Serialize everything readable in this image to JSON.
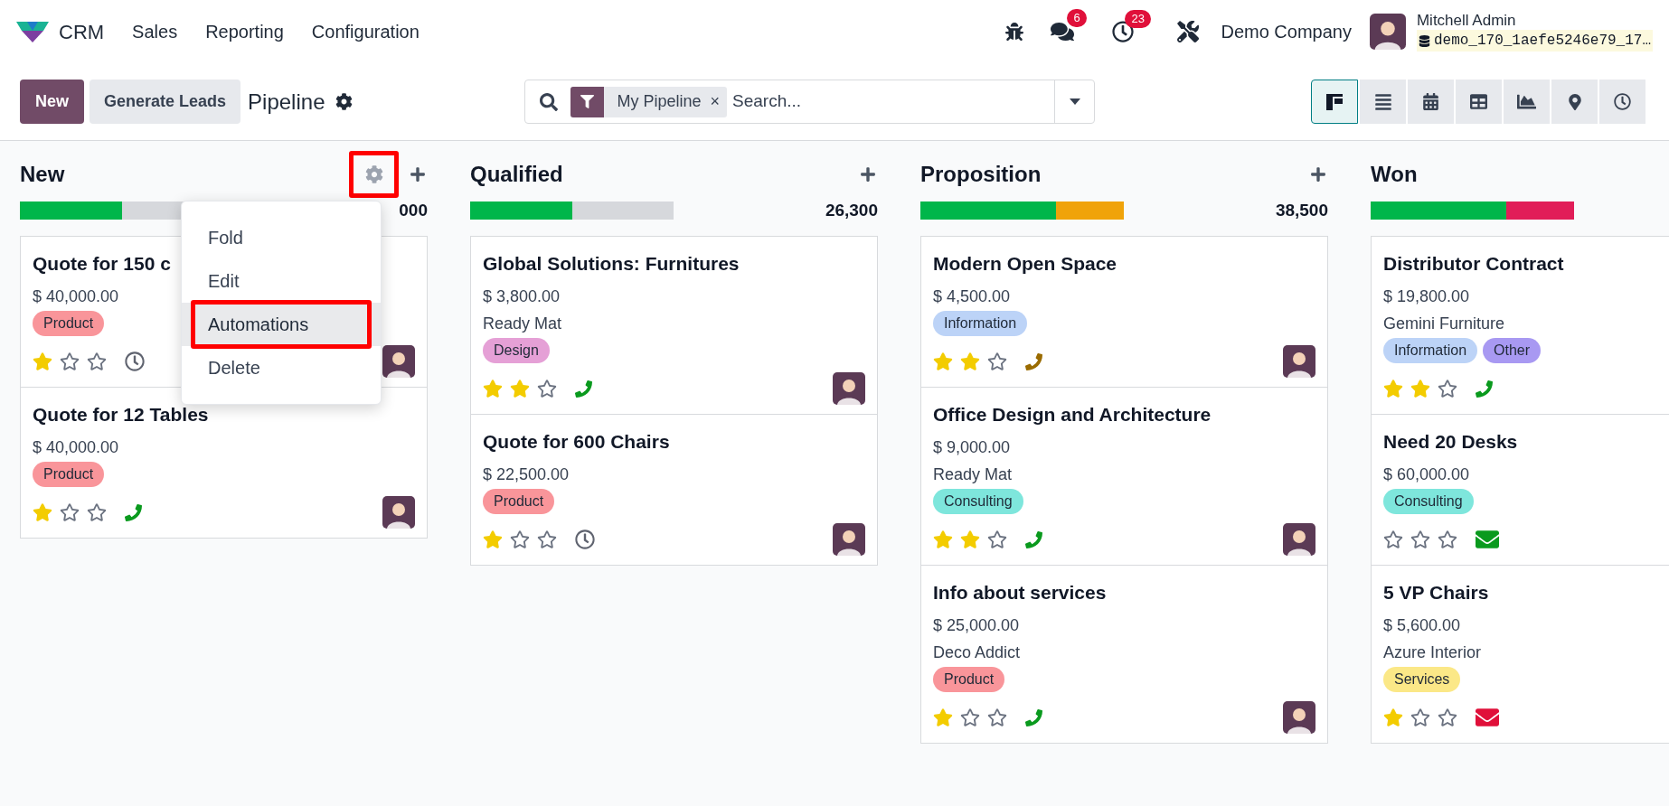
{
  "navbar": {
    "app_name": "CRM",
    "menu": [
      "Sales",
      "Reporting",
      "Configuration"
    ],
    "messages_badge": "6",
    "activities_badge": "23",
    "company": "Demo Company",
    "user": "Mitchell Admin",
    "database": "demo_170_1aefe5246e79_17…"
  },
  "control_panel": {
    "buttons": [
      {
        "label": "New",
        "kind": "primary"
      },
      {
        "label": "Generate Leads",
        "kind": "secondary"
      }
    ],
    "title": "Pipeline",
    "search": {
      "facet": "My Pipeline",
      "facet_remove": "×",
      "placeholder": "Search..."
    },
    "views": [
      {
        "kind": "kanban",
        "selected": true
      },
      {
        "kind": "list",
        "selected": false
      },
      {
        "kind": "calendar",
        "selected": false
      },
      {
        "kind": "pivot",
        "selected": false
      },
      {
        "kind": "graph",
        "selected": false
      },
      {
        "kind": "map",
        "selected": false
      },
      {
        "kind": "activity",
        "selected": false
      }
    ]
  },
  "columns": [
    {
      "title": "New",
      "aggregate": "000",
      "actions": [
        {
          "kind": "settings",
          "outlined": true
        },
        {
          "kind": "add"
        }
      ],
      "progress": {
        "color": "#00b64a",
        "level": 0.5,
        "track": {
          "color": "#d6d8dc"
        }
      },
      "cards": [
        {
          "title": "Quote for 150 c",
          "amount": "$ 40,000.00",
          "tags": [
            {
              "label": "Product",
              "color": "#f9959a"
            }
          ],
          "stars": 1,
          "activity": {
            "kind": "clock",
            "color": "#5f636f"
          },
          "avatar": true
        },
        {
          "title": "Quote for 12 Tables",
          "amount": "$ 40,000.00",
          "tags": [
            {
              "label": "Product",
              "color": "#f9959a"
            }
          ],
          "stars": 1,
          "activity": {
            "kind": "phone",
            "color": "#0a9a1e"
          },
          "avatar": true
        }
      ]
    },
    {
      "title": "Qualified",
      "aggregate": "26,300",
      "actions": [
        {
          "kind": "add"
        }
      ],
      "progress": {
        "color": "#00b64a",
        "level": 0.5,
        "track": {
          "color": "#d6d8dc"
        }
      },
      "cards": [
        {
          "title": "Global Solutions: Furnitures",
          "amount": "$ 3,800.00",
          "company": "Ready Mat",
          "tags": [
            {
              "label": "Design",
              "color": "#e5a0d6"
            }
          ],
          "stars": 2,
          "activity": {
            "kind": "phone",
            "color": "#0a9a1e"
          },
          "avatar": true
        },
        {
          "title": "Quote for 600 Chairs",
          "amount": "$ 22,500.00",
          "tags": [
            {
              "label": "Product",
              "color": "#f9959a"
            }
          ],
          "stars": 1,
          "activity": {
            "kind": "clock",
            "color": "#5f636f"
          },
          "avatar": true
        }
      ]
    },
    {
      "title": "Proposition",
      "aggregate": "38,500",
      "actions": [
        {
          "kind": "add"
        }
      ],
      "progress": {
        "color": "#00b64a",
        "level": 0.665,
        "track": {
          "color": "#f0a30a"
        }
      },
      "cards": [
        {
          "title": "Modern Open Space",
          "amount": "$ 4,500.00",
          "tags": [
            {
              "label": "Information",
              "color": "#bcd3f7"
            }
          ],
          "stars": 2,
          "activity": {
            "kind": "phone",
            "color": "#9a6b00"
          },
          "avatar": true
        },
        {
          "title": "Office Design and Architecture",
          "amount": "$ 9,000.00",
          "company": "Ready Mat",
          "tags": [
            {
              "label": "Consulting",
              "color": "#7ee6dc"
            }
          ],
          "stars": 2,
          "activity": {
            "kind": "phone",
            "color": "#0a9a1e"
          },
          "avatar": true
        },
        {
          "title": "Info about services",
          "amount": "$ 25,000.00",
          "company": "Deco Addict",
          "tags": [
            {
              "label": "Product",
              "color": "#f9959a"
            }
          ],
          "stars": 1,
          "activity": {
            "kind": "phone",
            "color": "#0a9a1e"
          },
          "avatar": true
        }
      ]
    },
    {
      "title": "Won",
      "progress": {
        "color": "#00b64a",
        "level": 0.665,
        "track": {
          "color": "#e11d58"
        }
      },
      "cards": [
        {
          "title": "Distributor Contract",
          "amount": "$ 19,800.00",
          "company": "Gemini Furniture",
          "tags": [
            {
              "label": "Information",
              "color": "#bcd3f7"
            },
            {
              "label": "Other",
              "color": "#a899f2"
            }
          ],
          "stars": 2,
          "activity": {
            "kind": "phone",
            "color": "#0a9a1e"
          },
          "avatar": false
        },
        {
          "title": "Need 20 Desks",
          "amount": "$ 60,000.00",
          "tags": [
            {
              "label": "Consulting",
              "color": "#7ee6dc"
            }
          ],
          "stars": 0,
          "activity": {
            "kind": "email",
            "color": "#0a9a1e"
          },
          "avatar": false
        },
        {
          "title": "5 VP Chairs",
          "amount": "$ 5,600.00",
          "company": "Azure Interior",
          "tags": [
            {
              "label": "Services",
              "color": "#fbe887"
            }
          ],
          "stars": 1,
          "activity": {
            "kind": "email",
            "color": "#e0103a"
          },
          "avatar": false
        }
      ]
    }
  ],
  "column_menu": {
    "items": [
      {
        "label": "Fold",
        "selected": false,
        "outlined": false
      },
      {
        "label": "Edit",
        "selected": false,
        "outlined": false
      },
      {
        "label": "Automations",
        "selected": true,
        "outlined": true
      },
      {
        "label": "Delete",
        "selected": false,
        "outlined": false
      }
    ]
  }
}
